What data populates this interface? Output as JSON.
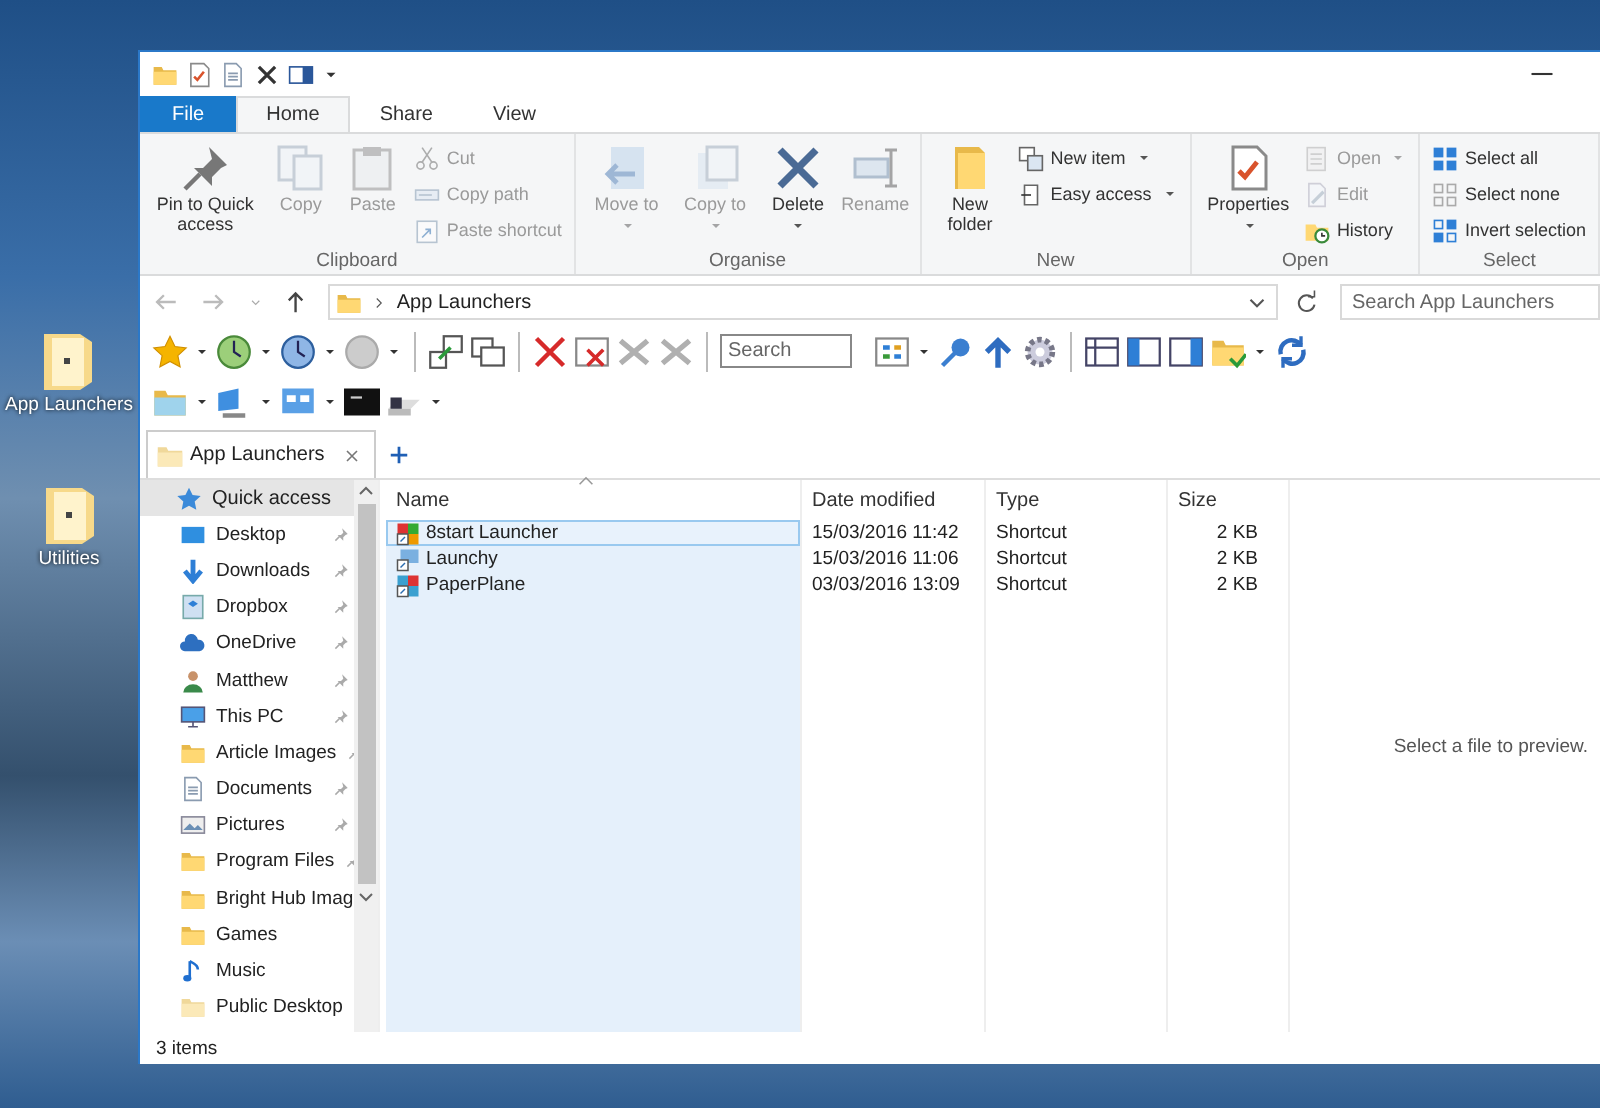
{
  "desktop_icons": [
    {
      "label": "App Launchers"
    },
    {
      "label": "Utilities"
    }
  ],
  "ribbon_tabs": [
    {
      "label": "File",
      "kind": "file",
      "selected": false
    },
    {
      "label": "Home",
      "kind": "tab",
      "selected": true
    },
    {
      "label": "Share",
      "kind": "tab",
      "selected": false
    },
    {
      "label": "View",
      "kind": "tab",
      "selected": false
    }
  ],
  "ribbon_groups": [
    {
      "title": "Clipboard",
      "items": [
        {
          "label": "Pin to Quick access",
          "kind": "large",
          "disabled": false,
          "dropdown": false
        },
        {
          "label": "Copy",
          "kind": "large",
          "disabled": true,
          "dropdown": false
        },
        {
          "label": "Paste",
          "kind": "large",
          "disabled": true,
          "dropdown": false
        },
        {
          "label": "Cut",
          "kind": "small",
          "disabled": true,
          "dropdown": false
        },
        {
          "label": "Copy path",
          "kind": "small",
          "disabled": true,
          "dropdown": false
        },
        {
          "label": "Paste shortcut",
          "kind": "small",
          "disabled": true,
          "dropdown": false
        }
      ]
    },
    {
      "title": "Organise",
      "items": [
        {
          "label": "Move to",
          "kind": "large",
          "disabled": true,
          "dropdown": true
        },
        {
          "label": "Copy to",
          "kind": "large",
          "disabled": true,
          "dropdown": true
        },
        {
          "label": "Delete",
          "kind": "large",
          "disabled": false,
          "dropdown": true
        },
        {
          "label": "Rename",
          "kind": "large",
          "disabled": true,
          "dropdown": false
        }
      ]
    },
    {
      "title": "New",
      "items": [
        {
          "label": "New folder",
          "kind": "large",
          "disabled": false,
          "dropdown": false
        },
        {
          "label": "New item",
          "kind": "small",
          "disabled": false,
          "dropdown": true
        },
        {
          "label": "Easy access",
          "kind": "small",
          "disabled": false,
          "dropdown": true
        }
      ]
    },
    {
      "title": "Open",
      "items": [
        {
          "label": "Properties",
          "kind": "large",
          "disabled": false,
          "dropdown": true
        },
        {
          "label": "Open",
          "kind": "small",
          "disabled": true,
          "dropdown": true
        },
        {
          "label": "Edit",
          "kind": "small",
          "disabled": true,
          "dropdown": false
        },
        {
          "label": "History",
          "kind": "small",
          "disabled": false,
          "dropdown": false
        }
      ]
    },
    {
      "title": "Select",
      "items": [
        {
          "label": "Select all",
          "kind": "small",
          "disabled": false,
          "dropdown": false
        },
        {
          "label": "Select none",
          "kind": "small",
          "disabled": false,
          "dropdown": false
        },
        {
          "label": "Invert selection",
          "kind": "small",
          "disabled": false,
          "dropdown": false
        }
      ]
    }
  ],
  "address_bar": {
    "path": "App Launchers",
    "search": {
      "placeholder": "Search App Launchers"
    }
  },
  "toolbar": {
    "search": {
      "placeholder": "Search"
    }
  },
  "folder_tabs": [
    {
      "label": "App Launchers",
      "selected": true
    }
  ],
  "nav_pane": {
    "header": {
      "label": "Quick access",
      "selected": true
    },
    "items": [
      {
        "label": "Desktop",
        "pinned": true,
        "selected": false
      },
      {
        "label": "Downloads",
        "pinned": true,
        "selected": false
      },
      {
        "label": "Dropbox",
        "pinned": true,
        "selected": false
      },
      {
        "label": "OneDrive",
        "pinned": true,
        "selected": false
      },
      {
        "label": "Matthew",
        "pinned": true,
        "selected": false
      },
      {
        "label": "This PC",
        "pinned": true,
        "selected": false
      },
      {
        "label": "Article Images",
        "pinned": true,
        "selected": false
      },
      {
        "label": "Documents",
        "pinned": true,
        "selected": false
      },
      {
        "label": "Pictures",
        "pinned": true,
        "selected": false
      },
      {
        "label": "Program Files",
        "pinned": true,
        "selected": false
      },
      {
        "label": "Bright Hub Imag",
        "pinned": false,
        "selected": false
      },
      {
        "label": "Games",
        "pinned": false,
        "selected": false
      },
      {
        "label": "Music",
        "pinned": false,
        "selected": false
      },
      {
        "label": "Public Desktop",
        "pinned": false,
        "selected": false
      }
    ]
  },
  "file_list": {
    "columns": [
      {
        "label": "Name",
        "sorted": true
      },
      {
        "label": "Date modified",
        "sorted": false
      },
      {
        "label": "Type",
        "sorted": false
      },
      {
        "label": "Size",
        "sorted": false
      }
    ],
    "rows": [
      {
        "cells": [
          "8start Launcher",
          "15/03/2016 11:42",
          "Shortcut",
          "2 KB"
        ],
        "focused": true
      },
      {
        "cells": [
          "Launchy",
          "15/03/2016 11:06",
          "Shortcut",
          "2 KB"
        ],
        "focused": false
      },
      {
        "cells": [
          "PaperPlane",
          "03/03/2016 13:09",
          "Shortcut",
          "2 KB"
        ],
        "focused": false
      }
    ]
  },
  "preview_pane": {
    "message": "Select a file to preview."
  },
  "status_bar": {
    "item_count": "3 items"
  }
}
